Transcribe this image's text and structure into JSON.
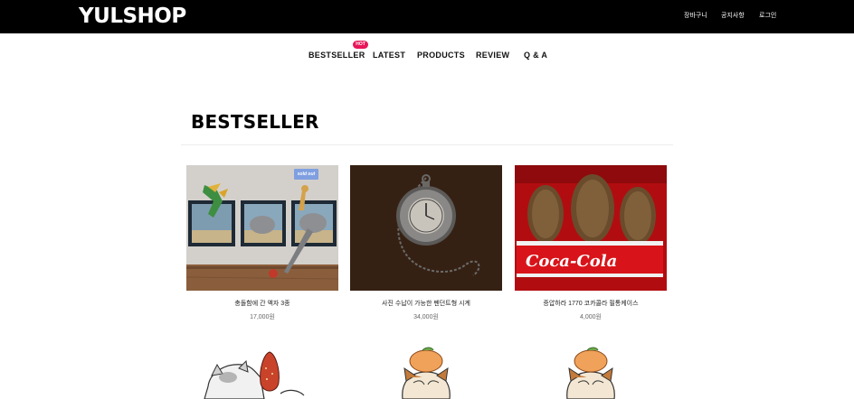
{
  "header": {
    "logo": "YULSHOP",
    "utility_links": [
      "장바구니",
      "공지사항",
      "로그인"
    ]
  },
  "nav": {
    "items": [
      "BESTSELLER",
      "LATEST",
      "PRODUCTS",
      "REVIEW",
      "Q & A"
    ],
    "badge": "HOT"
  },
  "section": {
    "title": "BESTSELLER"
  },
  "products": [
    {
      "name": "충돌함에 간 액자 3종",
      "price": "17,000원",
      "badge": "sold out"
    },
    {
      "name": "사진 수납이 가능한 펜던트형 시계",
      "price": "34,000원"
    },
    {
      "name": "증압하라 1770 코카콜라 필통케이스",
      "price": "4,000원"
    },
    {
      "name": "",
      "price": ""
    },
    {
      "name": "",
      "price": ""
    },
    {
      "name": "",
      "price": ""
    }
  ],
  "colors": {
    "topbar": "#000000",
    "hot_badge": "#e8155a",
    "soldout_badge": "#7f9fe0"
  }
}
